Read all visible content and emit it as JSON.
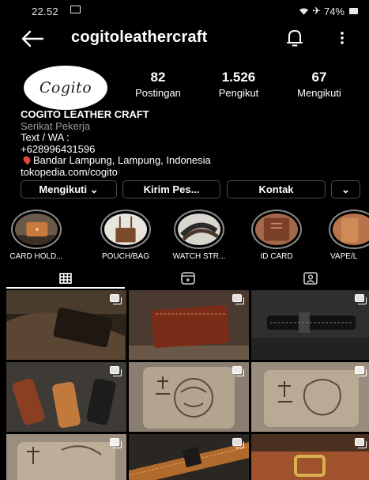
{
  "status_bar": {
    "time": "22.52",
    "battery": "74%"
  },
  "header": {
    "username": "cogitoleathercraft"
  },
  "profile": {
    "avatar_text": "Cogito",
    "stats": [
      {
        "value": "82",
        "label": "Postingan"
      },
      {
        "value": "1.526",
        "label": "Pengikut"
      },
      {
        "value": "67",
        "label": "Mengikuti"
      }
    ],
    "name": "COGITO LEATHER CRAFT",
    "category": "Serikat Pekerja",
    "bio_line1": "Text / WA :",
    "bio_line2": "+628996431596",
    "location": "Bandar Lampung, Lampung, Indonesia",
    "link": "tokopedia.com/cogito"
  },
  "actions": {
    "follow": "Mengikuti ⌄",
    "message": "Kirim Pes...",
    "contact": "Kontak",
    "more": "⌄"
  },
  "highlights": [
    {
      "label": "CARD HOLD..."
    },
    {
      "label": "POUCH/BAG"
    },
    {
      "label": "WATCH STR..."
    },
    {
      "label": "ID CARD"
    },
    {
      "label": "VAPE/L"
    }
  ],
  "colors": {
    "background": "#000000",
    "secondary_text": "#9a9a9a",
    "button_border": "#4a4a4a",
    "pin": "#e0473a"
  }
}
